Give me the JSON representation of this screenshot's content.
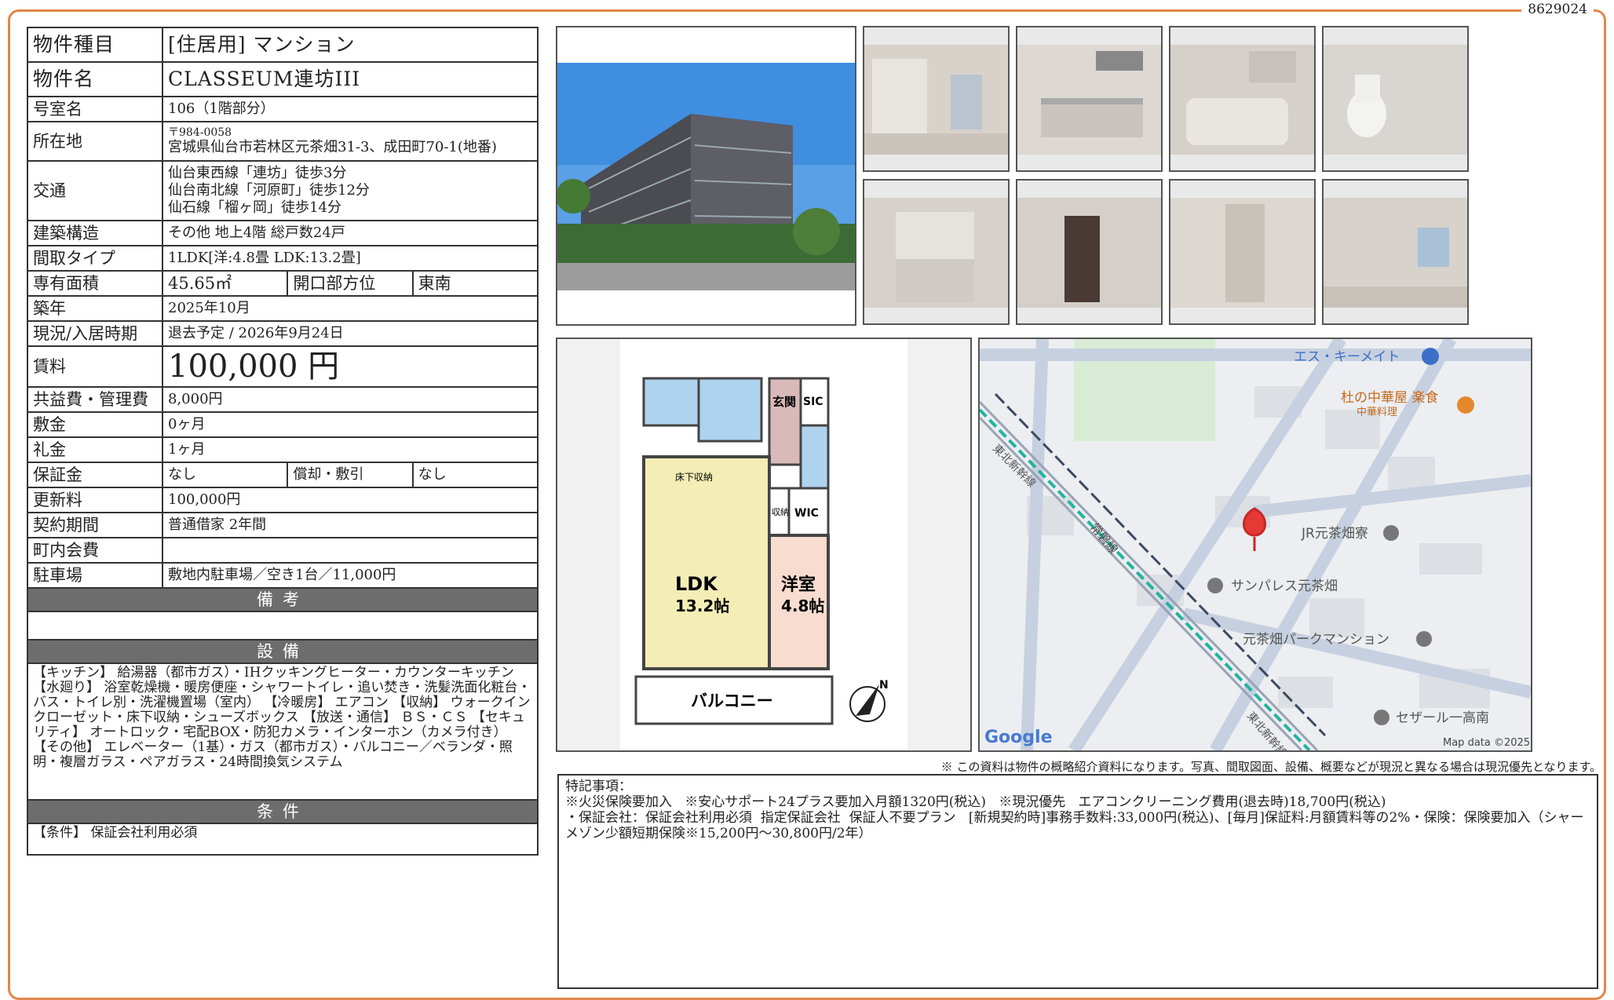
{
  "doc_id": "8629024",
  "property": {
    "type_label": "物件種目",
    "type_value": "[住居用]  マンション",
    "name_label": "物件名",
    "name_value": "CLASSEUM連坊III",
    "room_label": "号室名",
    "room_value": "106（1階部分）",
    "address_label": "所在地",
    "postal": "〒984-0058",
    "address_value": "宮城県仙台市若林区元茶畑31-3、成田町70-1(地番)",
    "access_label": "交通",
    "access": [
      "仙台東西線「連坊」徒歩3分",
      "仙台南北線「河原町」徒歩12分",
      "仙石線「榴ヶ岡」徒歩14分"
    ],
    "structure_label": "建築構造",
    "structure_value": "その他  地上4階  総戸数24戸",
    "layout_label": "間取タイプ",
    "layout_value": "1LDK[洋:4.8畳  LDK:13.2畳]",
    "area_label": "専有面積",
    "area_value": "45.65㎡",
    "direction_label": "開口部方位",
    "direction_value": "東南",
    "built_label": "築年",
    "built_value": "2025年10月",
    "status_label": "現況/入居時期",
    "status_value": "退去予定  /  2026年9月24日",
    "rent_label": "賃料",
    "rent_value": "100,000 円",
    "fee_label": "共益費・管理費",
    "fee_value": "8,000円",
    "deposit_label": "敷金",
    "deposit_value": "0ヶ月",
    "key_money_label": "礼金",
    "key_money_value": "1ヶ月",
    "guarantee_label": "保証金",
    "guarantee_value": "なし",
    "amort_label": "償却・敷引",
    "amort_value": "なし",
    "renewal_label": "更新料",
    "renewal_value": "100,000円",
    "contract_label": "契約期間",
    "contract_value": "普通借家  2年間",
    "community_label": "町内会費",
    "community_value": "",
    "parking_label": "駐車場",
    "parking_value": "敷地内駐車場／空き1台／11,000円"
  },
  "sections": {
    "remarks_title": "備考",
    "facilities_title": "設備",
    "facilities_text": "【キッチン】 給湯器（都市ガス）・IHクッキングヒーター・カウンターキッチン 【水廻り】 浴室乾燥機・暖房便座・シャワートイレ・追い焚き・洗髪洗面化粧台・バス・トイレ別・洗濯機置場（室内） 【冷暖房】 エアコン 【収納】 ウォークインクローゼット・床下収納・シューズボックス 【放送・通信】 ＢＳ・ＣＳ 【セキュリティ】 オートロック・宅配BOX・防犯カメラ・インターホン（カメラ付き） 【その他】 エレベーター（1基）・ガス（都市ガス）・バルコニー／ベランダ・照明・複層ガラス・ペアガラス・24時間換気システム",
    "conditions_title": "条件",
    "conditions_text": "【条件】 保証会社利用必須"
  },
  "floorplan": {
    "genkan": "玄関",
    "sic": "SIC",
    "yukashita": "床下収納",
    "shuno": "収納",
    "wic": "WIC",
    "ldk": "LDK",
    "ldk_size": "13.2帖",
    "yoshitsu": "洋室",
    "yoshitsu_size": "4.8帖",
    "balcony": "バルコニー",
    "north": "N"
  },
  "map": {
    "places": [
      "エス・キーメイト",
      "杜の中華屋 楽食",
      "中華料理",
      "JR元茶畑寮",
      "サンパレス元茶畑",
      "元茶畑パークマンション",
      "セザール一高南"
    ],
    "lines": [
      "東北新幹線",
      "常磐線",
      "東北新幹線"
    ],
    "logo": "Google",
    "copyright": "Map data ©2025"
  },
  "disclaimer": "※ この資料は物件の概略紹介資料になります。写真、間取図面、設備、概要などが現況と異なる場合は現況優先となります。",
  "notes": {
    "title": "特記事項：",
    "line1": "※火災保険要加入   ※安心サポート24プラス要加入月額1320円(税込)   ※現況優先   エアコンクリーニング費用(退去時)18,700円(税込)",
    "line2": "・保証会社：保証会社利用必須  指定保証会社  保証人不要プラン   [新規契約時]事務手数料:33,000円(税込)、[毎月]保証料:月額賃料等の2%・保険：保険要加入（シャーメゾン少額短期保険※15,200円～30,800円/2年）"
  },
  "colors": {
    "frame": "#e0874a",
    "section_bg": "#6d6d6d"
  }
}
